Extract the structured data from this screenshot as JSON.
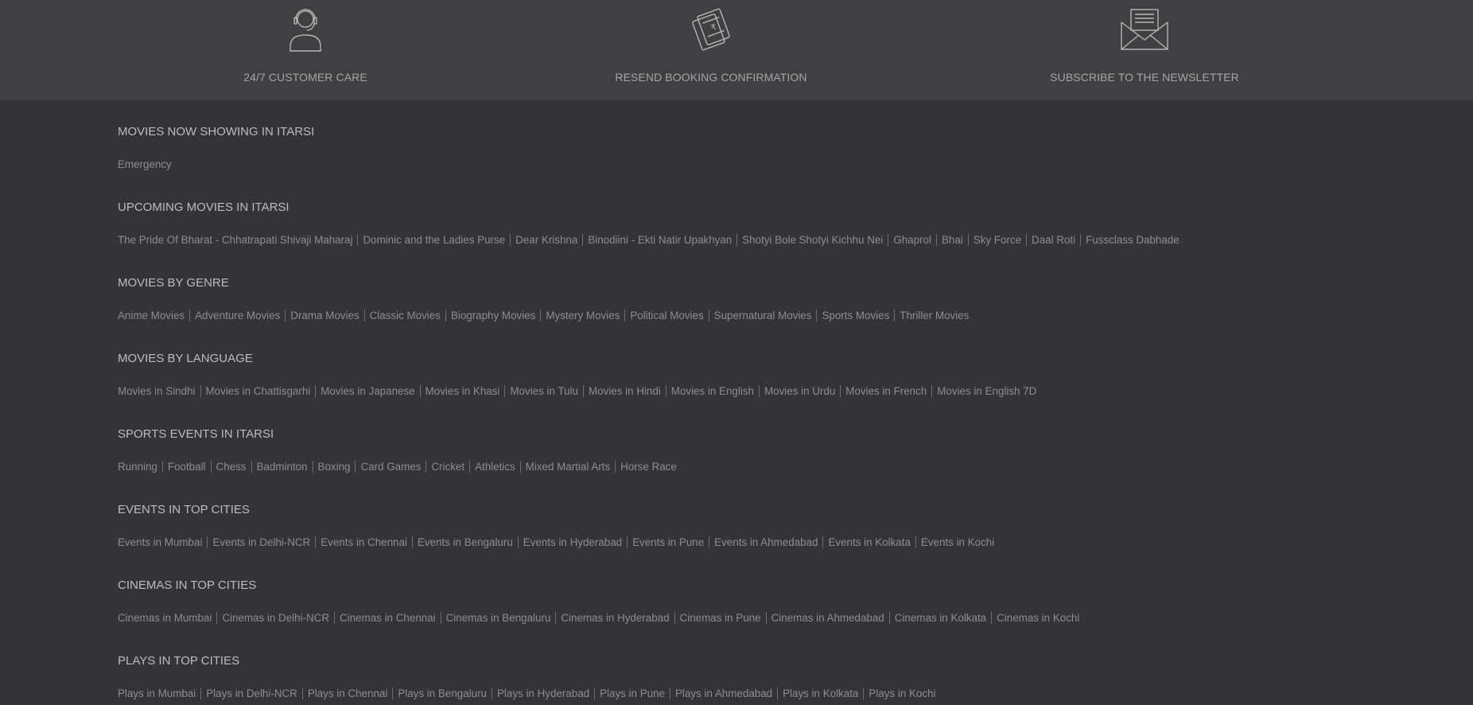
{
  "features": [
    {
      "label": "24/7 CUSTOMER CARE",
      "icon": "customer-care-icon"
    },
    {
      "label": "RESEND BOOKING CONFIRMATION",
      "icon": "ticket-icon"
    },
    {
      "label": "SUBSCRIBE TO THE NEWSLETTER",
      "icon": "newsletter-envelope-icon"
    }
  ],
  "sections": [
    {
      "heading": "MOVIES NOW SHOWING IN ITARSI",
      "links": [
        "Emergency"
      ]
    },
    {
      "heading": "UPCOMING MOVIES IN ITARSI",
      "links": [
        "The Pride Of Bharat - Chhatrapati Shivaji Maharaj",
        "Dominic and the Ladies Purse",
        "Dear Krishna",
        "Binodiini - Ekti Natir Upakhyan",
        "Shotyi Bole Shotyi Kichhu Nei",
        "Ghaprol",
        "Bhai",
        "Sky Force",
        "Daal Roti",
        "Fussclass Dabhade"
      ]
    },
    {
      "heading": "MOVIES BY GENRE",
      "links": [
        "Anime Movies",
        "Adventure Movies",
        "Drama Movies",
        "Classic Movies",
        "Biography Movies",
        "Mystery Movies",
        "Political Movies",
        "Supernatural Movies",
        "Sports Movies",
        "Thriller Movies"
      ]
    },
    {
      "heading": "MOVIES BY LANGUAGE",
      "links": [
        "Movies in Sindhi",
        "Movies in Chattisgarhi",
        "Movies in Japanese",
        "Movies in Khasi",
        "Movies in Tulu",
        "Movies in Hindi",
        "Movies in English",
        "Movies in Urdu",
        "Movies in French",
        "Movies in English 7D"
      ]
    },
    {
      "heading": "SPORTS EVENTS IN ITARSI",
      "links": [
        "Running",
        "Football",
        "Chess",
        "Badminton",
        "Boxing",
        "Card Games",
        "Cricket",
        "Athletics",
        "Mixed Martial Arts",
        "Horse Race"
      ]
    },
    {
      "heading": "EVENTS IN TOP CITIES",
      "links": [
        "Events in Mumbai",
        "Events in Delhi-NCR",
        "Events in Chennai",
        "Events in Bengaluru",
        "Events in Hyderabad",
        "Events in Pune",
        "Events in Ahmedabad",
        "Events in Kolkata",
        "Events in Kochi"
      ]
    },
    {
      "heading": "CINEMAS IN TOP CITIES",
      "links": [
        "Cinemas in Mumbai",
        "Cinemas in Delhi-NCR",
        "Cinemas in Chennai",
        "Cinemas in Bengaluru",
        "Cinemas in Hyderabad",
        "Cinemas in Pune",
        "Cinemas in Ahmedabad",
        "Cinemas in Kolkata",
        "Cinemas in Kochi"
      ]
    },
    {
      "heading": "PLAYS IN TOP CITIES",
      "links": [
        "Plays in Mumbai",
        "Plays in Delhi-NCR",
        "Plays in Chennai",
        "Plays in Bengaluru",
        "Plays in Hyderabad",
        "Plays in Pune",
        "Plays in Ahmedabad",
        "Plays in Kolkata",
        "Plays in Kochi"
      ]
    }
  ]
}
